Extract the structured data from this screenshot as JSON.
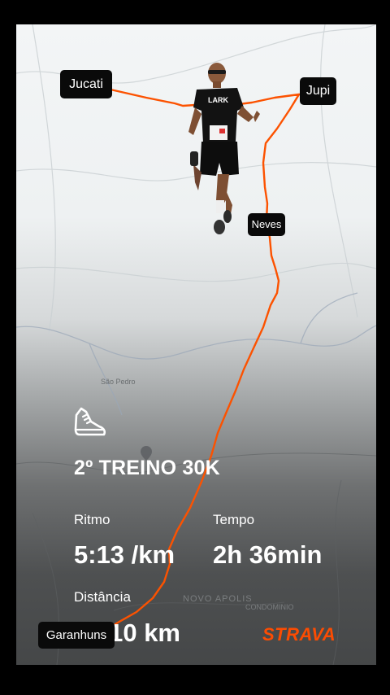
{
  "activity": {
    "title": "2º TREINO 30K",
    "stats": {
      "pace_label": "Ritmo",
      "pace_value": "5:13 /km",
      "time_label": "Tempo",
      "time_value": "2h 36min",
      "distance_label": "Distância",
      "distance_value": "30,10 km"
    },
    "icon": "running-shoe-icon"
  },
  "map": {
    "places": {
      "jucati": "Jucati",
      "jupi": "Jupi",
      "neves": "Neves",
      "garanhuns": "Garanhuns"
    },
    "map_text": {
      "sao_pedro": "São Pedro",
      "bottom_town": "NOVO APOLIS",
      "condominio": "CONDOMINIO"
    },
    "route_color": "#fc5200"
  },
  "brand": {
    "name": "STRAVA",
    "color": "#fc4c02"
  }
}
